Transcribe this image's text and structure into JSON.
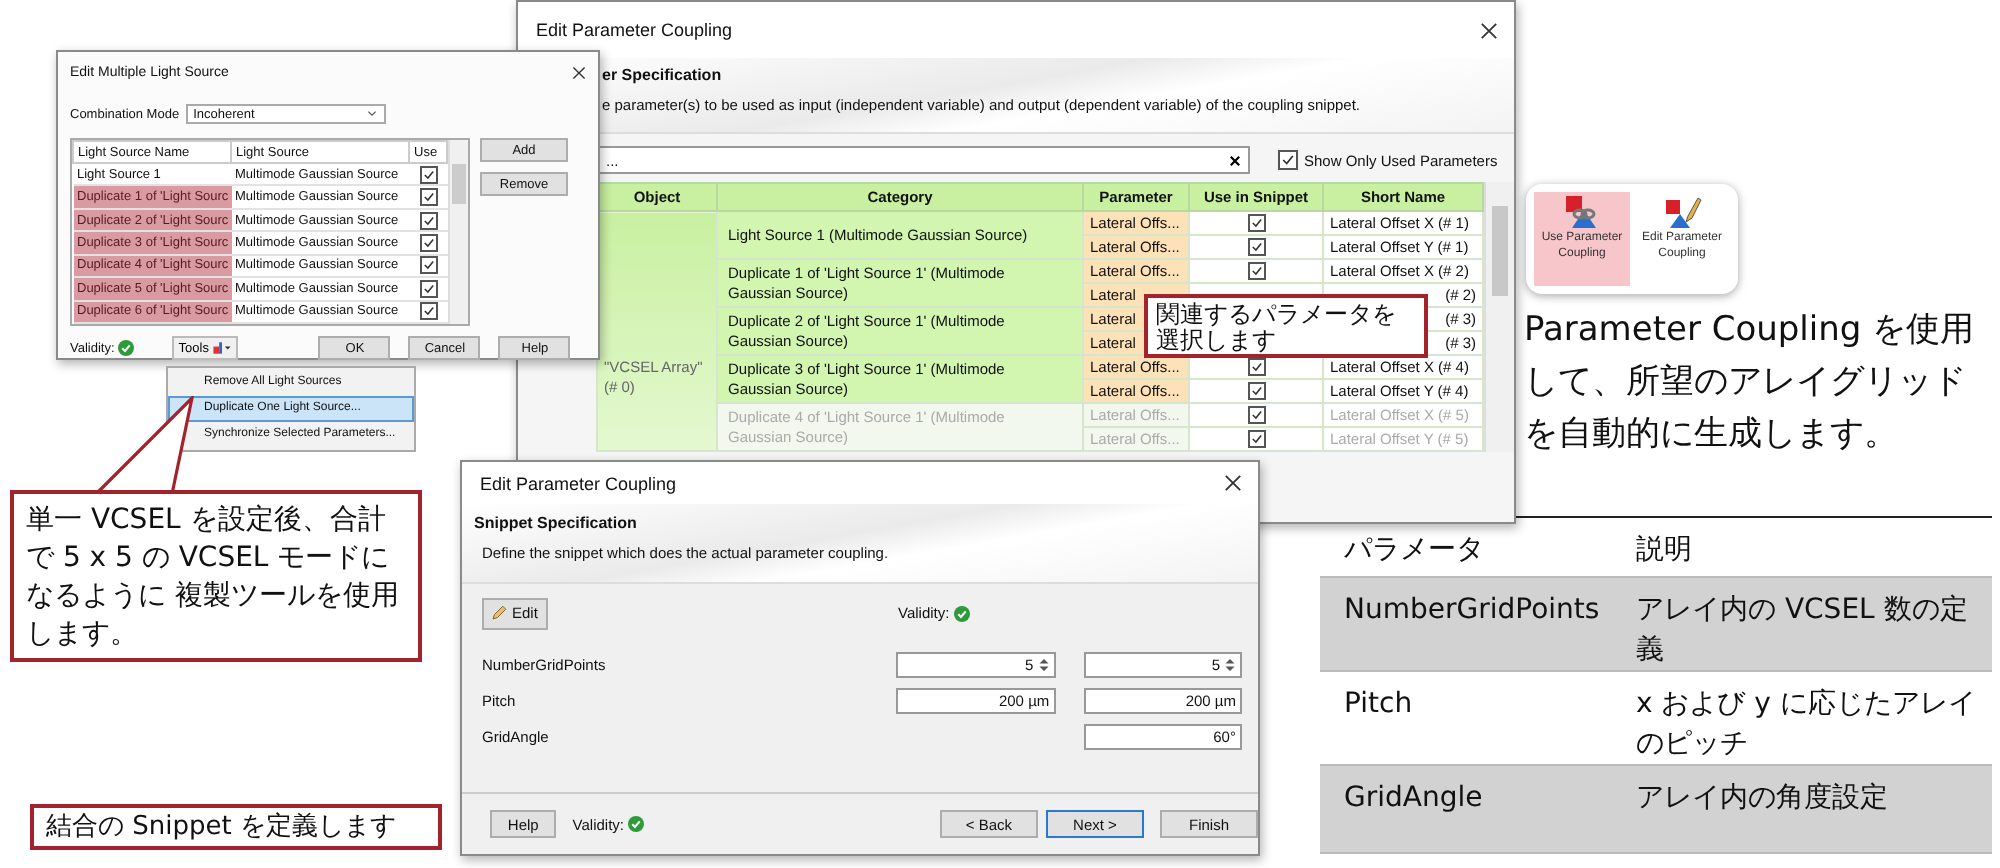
{
  "parameter_dialog": {
    "title": "Edit Parameter Coupling",
    "header_title": "er Specification",
    "header_text": "e parameter(s) to be used as input (independent variable) and output (dependent variable) of the coupling snippet.",
    "search": {
      "value": "..."
    },
    "show_only_used": {
      "label": "Show Only Used Parameters",
      "checked": true
    },
    "columns": [
      "Object",
      "Category",
      "Parameter",
      "Use in Snippet",
      "Short Name"
    ],
    "object": "\"VCSEL Array\" (# 0)",
    "groups": [
      {
        "category": "Light Source 1 (Multimode Gaussian Source)",
        "rows": [
          {
            "kind": "normal",
            "parameter": "Lateral Offs...",
            "use": true,
            "short_name": "Lateral Offset X (# 1)"
          },
          {
            "kind": "normal",
            "parameter": "Lateral Offs...",
            "use": true,
            "short_name": "Lateral Offset Y (# 1)"
          }
        ]
      },
      {
        "category": "Duplicate 1 of 'Light Source 1' (Multimode Gaussian Source)",
        "rows": [
          {
            "kind": "normal",
            "parameter": "Lateral Offs...",
            "use": true,
            "short_name": "Lateral Offset X (# 2)"
          },
          {
            "kind": "covered",
            "parameter": "Lateral",
            "short_name": "(# 2)"
          }
        ]
      },
      {
        "category": "Duplicate 2 of 'Light Source 1' (Multimode Gaussian Source)",
        "rows": [
          {
            "kind": "covered",
            "parameter": "Lateral",
            "short_name": "(# 3)"
          },
          {
            "kind": "covered",
            "parameter": "Lateral",
            "short_name": "(# 3)"
          }
        ]
      },
      {
        "category": "Duplicate 3 of 'Light Source 1' (Multimode Gaussian Source)",
        "rows": [
          {
            "kind": "normal",
            "parameter": "Lateral Offs...",
            "use": true,
            "short_name": "Lateral Offset X (# 4)"
          },
          {
            "kind": "normal",
            "parameter": "Lateral Offs...",
            "use": true,
            "short_name": "Lateral Offset Y (# 4)"
          }
        ]
      },
      {
        "category": "Duplicate 4 of 'Light Source 1' (Multimode Gaussian Source)",
        "rows": [
          {
            "kind": "normal",
            "parameter": "Lateral Offs...",
            "use": true,
            "short_name": "Lateral Offset X (# 5)"
          },
          {
            "kind": "normal",
            "parameter": "Lateral Offs...",
            "use": true,
            "short_name": "Lateral Offset Y (# 5)"
          }
        ]
      }
    ]
  },
  "light_source_dialog": {
    "title": "Edit Multiple Light Source",
    "combination_mode": {
      "label": "Combination Mode",
      "value": "Incoherent"
    },
    "columns": [
      "Light Source Name",
      "Light Source",
      "Use"
    ],
    "rows": [
      {
        "name": "Light Source 1",
        "source": "Multimode Gaussian Source",
        "use": true,
        "selected": false
      },
      {
        "name": "Duplicate 1 of 'Light Sourc",
        "source": "Multimode Gaussian Source",
        "use": true,
        "selected": true
      },
      {
        "name": "Duplicate 2 of 'Light Sourc",
        "source": "Multimode Gaussian Source",
        "use": true,
        "selected": true
      },
      {
        "name": "Duplicate 3 of 'Light Sourc",
        "source": "Multimode Gaussian Source",
        "use": true,
        "selected": true
      },
      {
        "name": "Duplicate 4 of 'Light Sourc",
        "source": "Multimode Gaussian Source",
        "use": true,
        "selected": true
      },
      {
        "name": "Duplicate 5 of 'Light Sourc",
        "source": "Multimode Gaussian Source",
        "use": true,
        "selected": true
      },
      {
        "name": "Duplicate 6 of 'Light Sourc",
        "source": "Multimode Gaussian Source",
        "use": true,
        "selected": true
      }
    ],
    "side_buttons": [
      "Add",
      "Remove"
    ],
    "validity": "Validity:",
    "tools": "Tools",
    "buttons": [
      "OK",
      "Cancel",
      "Help"
    ]
  },
  "tools_menu": [
    {
      "label": "Remove All Light Sources",
      "selected": false
    },
    {
      "label": "Duplicate One Light Source...",
      "selected": true
    },
    {
      "label": "Synchronize Selected Parameters...",
      "selected": false
    }
  ],
  "callout_duplicate": "単一 VCSEL を設定後、合計で 5 x 5 の VCSEL モードになるように 複製ツールを使用します。",
  "callout_select": "関連するパラメータを選択します",
  "snippet_dialog": {
    "title": "Edit Parameter Coupling",
    "header_title": "Snippet Specification",
    "header_text": "Define the snippet which does the actual parameter coupling.",
    "edit_button": "Edit",
    "validity": "Validity:",
    "params": [
      {
        "name": "NumberGridPoints",
        "kind": "spin",
        "value_1": "5",
        "value_2": "5"
      },
      {
        "name": "Pitch",
        "kind": "text",
        "value_1": "200 µm",
        "value_2": "200 µm"
      },
      {
        "name": "GridAngle",
        "kind": "text",
        "value_2": "60°"
      }
    ],
    "help": "Help",
    "footer_validity": "Validity:",
    "nav_buttons": [
      {
        "label": "< Back",
        "selected": false
      },
      {
        "label": "Next >",
        "selected": true
      },
      {
        "label": "Finish",
        "selected": false
      }
    ]
  },
  "callout_snippet": "結合の Snippet を定義します",
  "ribbon": [
    {
      "kind": "use",
      "label": "Use Parameter Coupling",
      "selected": true
    },
    {
      "kind": "edit",
      "label": "Edit Parameter Coupling",
      "selected": false
    }
  ],
  "description": "Parameter Coupling を使用して、所望のアレイグリッドを自動的に生成します。",
  "parameter_table": {
    "columns": [
      "パラメータ",
      "説明"
    ],
    "rows": [
      {
        "name": "NumberGridPoints",
        "description": "アレイ内の VCSEL 数の定義"
      },
      {
        "name": "Pitch",
        "description": "x および y に応じたアレイのピッチ"
      },
      {
        "name": "GridAngle",
        "description": "アレイ内の角度設定"
      }
    ]
  }
}
